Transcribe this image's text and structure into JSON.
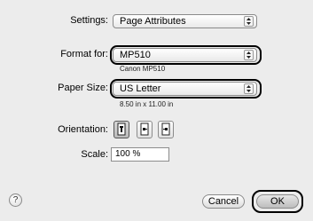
{
  "settings": {
    "label": "Settings:",
    "value": "Page Attributes"
  },
  "format_for": {
    "label": "Format for:",
    "value": "MP510",
    "sub": "Canon MP510"
  },
  "paper_size": {
    "label": "Paper Size:",
    "value": "US Letter",
    "sub": "8.50 in x 11.00 in"
  },
  "orientation": {
    "label": "Orientation:",
    "options": [
      "portrait",
      "landscape-left",
      "landscape-right"
    ],
    "selected": "portrait"
  },
  "scale": {
    "label": "Scale:",
    "value": "100 %"
  },
  "help": {
    "glyph": "?"
  },
  "buttons": {
    "cancel": "Cancel",
    "ok": "OK"
  }
}
